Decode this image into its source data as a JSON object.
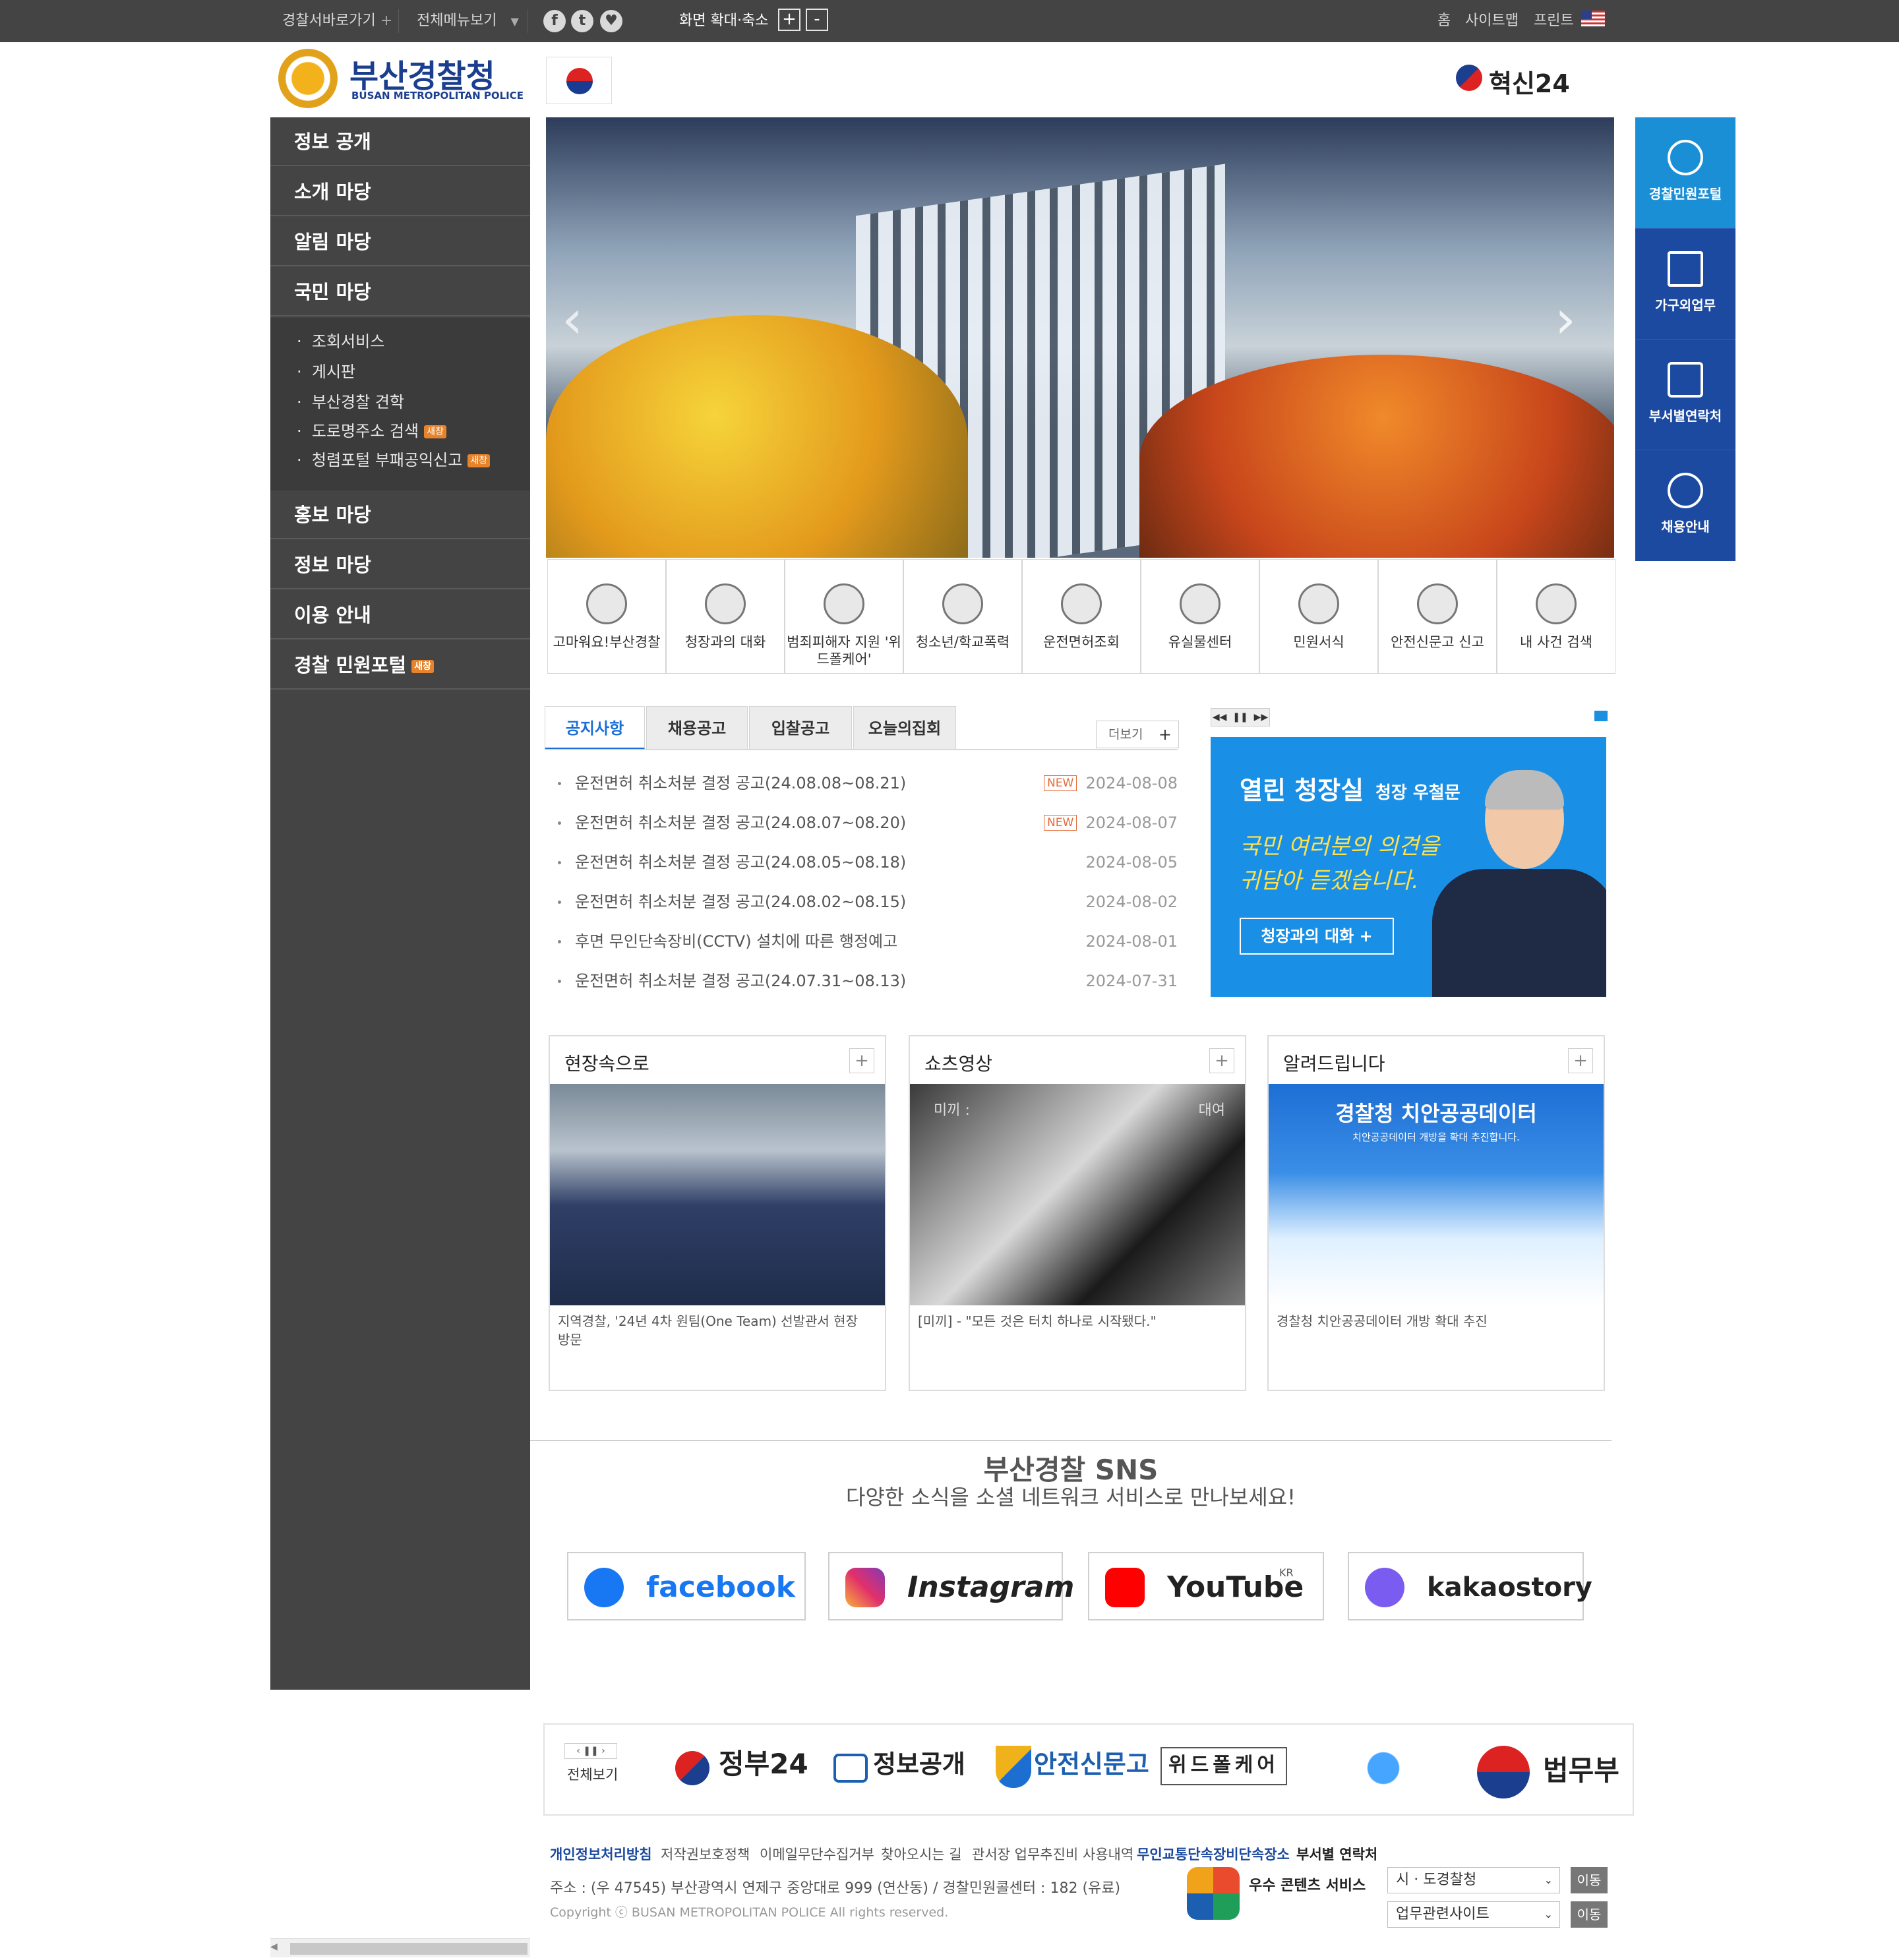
{
  "topbar": {
    "police_shortcut": "경찰서바로가기",
    "all_menu": "전체메뉴보기",
    "zoom_label": "화면 확대·축소",
    "zoom_in": "+",
    "zoom_out": "-",
    "home": "홈",
    "sitemap": "사이트맵",
    "print": "프린트"
  },
  "header": {
    "logo_title": "부산경찰청",
    "logo_sub": "BUSAN METROPOLITAN POLICE",
    "innovation": "혁신24"
  },
  "leftnav": {
    "items": [
      "정보 공개",
      "소개 마당",
      "알림 마당",
      "국민 마당",
      "홍보 마당",
      "정보 마당",
      "이용 안내",
      "경찰 민원포털"
    ],
    "subitems": [
      "조회서비스",
      "게시판",
      "부산경찰 견학",
      "도로명주소 검색",
      "청렴포털 부패공익신고"
    ],
    "badge": "새창"
  },
  "quick": {
    "items": [
      "경찰민원포털",
      "가구외업무",
      "부서별연락처",
      "채용안내"
    ],
    "colors": [
      "#1a8fd6",
      "#1b4aa0",
      "#1b4aa0",
      "#1b4aa0"
    ]
  },
  "services": [
    "고마워요!부산경찰",
    "청장과의 대화",
    "범죄피해자 지원 '위드폴케어'",
    "청소년/학교폭력",
    "운전면허조회",
    "유실물센터",
    "민원서식",
    "안전신문고 신고",
    "내 사건 검색"
  ],
  "tabs": [
    "공지사항",
    "채용공고",
    "입찰공고",
    "오늘의집회"
  ],
  "more": "더보기",
  "notices": [
    {
      "title": "운전면허 취소처분 결정 공고(24.08.08~08.21)",
      "date": "2024-08-08",
      "new": "NEW"
    },
    {
      "title": "운전면허 취소처분 결정 공고(24.08.07~08.20)",
      "date": "2024-08-07",
      "new": "NEW"
    },
    {
      "title": "운전면허 취소처분 결정 공고(24.08.05~08.18)",
      "date": "2024-08-05",
      "new": ""
    },
    {
      "title": "운전면허 취소처분 결정 공고(24.08.02~08.15)",
      "date": "2024-08-02",
      "new": ""
    },
    {
      "title": "후면 무인단속장비(CCTV) 설치에 따른 행정예고",
      "date": "2024-08-01",
      "new": ""
    },
    {
      "title": "운전면허 취소처분 결정 공고(24.07.31~08.13)",
      "date": "2024-07-31",
      "new": ""
    }
  ],
  "chief": {
    "title": "열린 청장실",
    "name": "청장 우철문",
    "msg1": "국민 여러분의 의견을",
    "msg2": "귀담아 듣겠습니다.",
    "button": "청장과의 대화 +"
  },
  "gallery": [
    {
      "title": "현장속으로",
      "caption": "지역경찰, '24년 4차 원팀(One Team) 선발관서 현장 방문"
    },
    {
      "title": "쇼츠영상",
      "caption": "[미끼] - \"모든 것은 터치 하나로 시작됐다.\""
    },
    {
      "title": "알려드립니다",
      "caption": "경찰청 치안공공데이터 개방 확대 추진"
    }
  ],
  "gallery_img": {
    "short_1": "미끼 :",
    "short_2": "대여",
    "notice_1": "경찰청 치안공공데이터",
    "notice_2": "치안공공데이터 개방을 확대 추진합니다."
  },
  "sns": {
    "title": "부산경찰 SNS",
    "subtitle": "다양한 소식을 소셜 네트워크 서비스로 만나보세요!",
    "items": [
      "facebook",
      "Instagram",
      "YouTube",
      "kakaostory"
    ],
    "kr": "KR"
  },
  "banners": {
    "view_all": "전체보기",
    "items": [
      "정부24",
      "정보공개",
      "안전신문고",
      "위드폴케어",
      "법무부"
    ]
  },
  "footer": {
    "links": [
      "개인정보처리방침",
      "저작권보호정책",
      "이메일무단수집거부",
      "찾아오시는 길",
      "관서장 업무추진비 사용내역",
      "무인교통단속장비단속장소",
      "부서별 연락처"
    ],
    "address": "주소 : (우 47545) 부산광역시 연제구 중앙대로 999 (연산동) / 경찰민원콜센터 : 182 (유료)",
    "copyright": "Copyright ⓒ BUSAN METROPOLITAN POLICE All rights reserved.",
    "award": "우수 콘텐츠 서비스",
    "select1": "시 · 도경찰청",
    "select2": "업무관련사이트",
    "go": "이동"
  }
}
